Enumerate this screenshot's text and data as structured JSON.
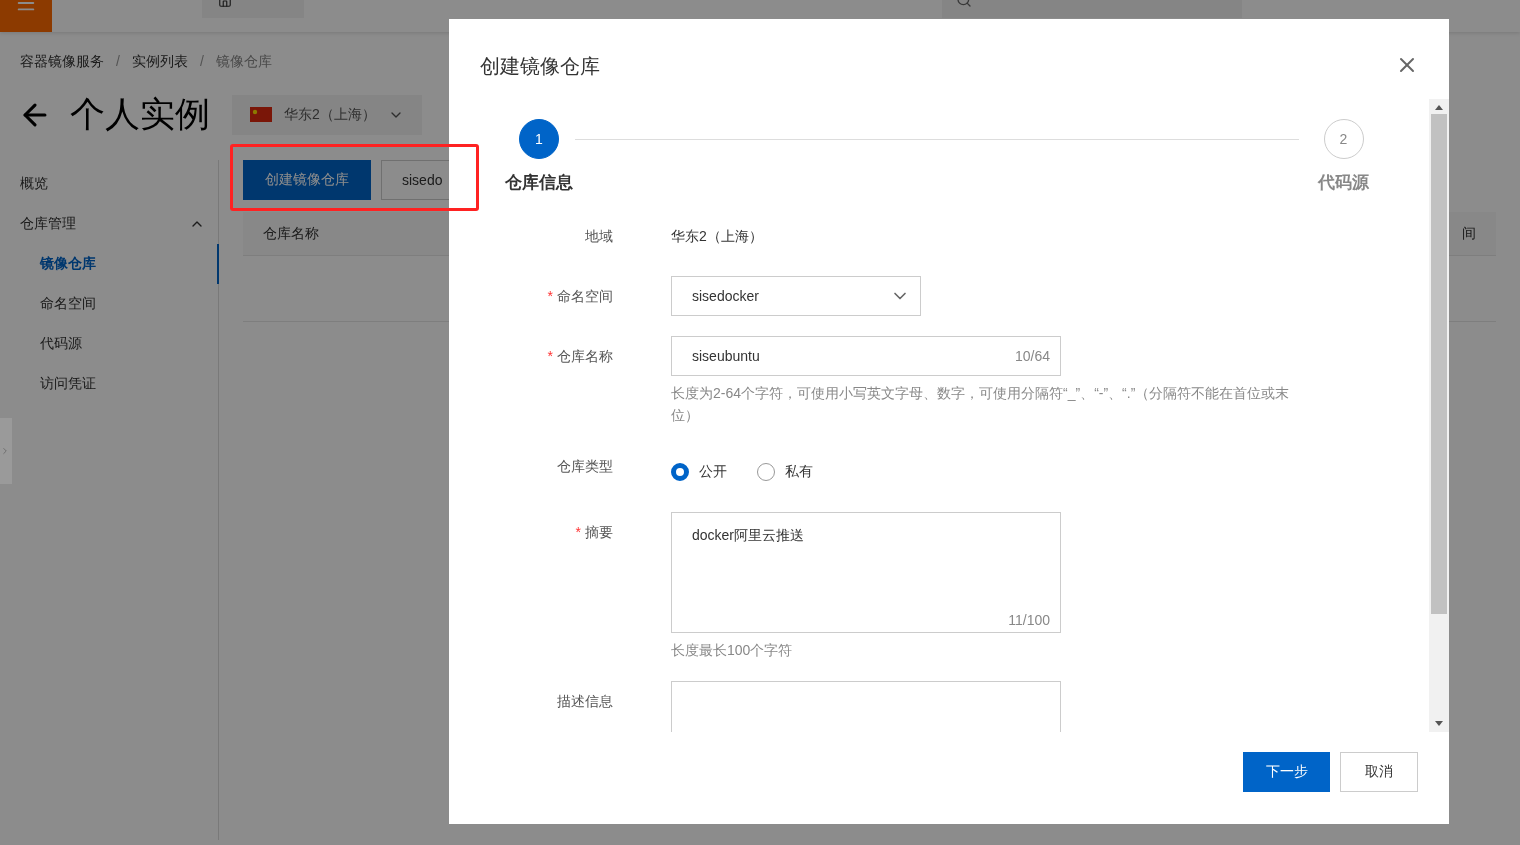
{
  "breadcrumb": {
    "items": [
      "容器镜像服务",
      "实例列表",
      "镜像仓库"
    ],
    "separator": "/"
  },
  "page_title": "个人实例",
  "region": "华东2（上海）",
  "sidebar": {
    "items": [
      {
        "label": "概览",
        "selected": false
      },
      {
        "label": "仓库管理",
        "selected": false,
        "expanded": true,
        "children": [
          {
            "label": "镜像仓库",
            "selected": true
          },
          {
            "label": "命名空间",
            "selected": false
          },
          {
            "label": "代码源",
            "selected": false
          },
          {
            "label": "访问凭证",
            "selected": false
          }
        ]
      }
    ]
  },
  "toolbar": {
    "create_button": "创建镜像仓库",
    "namespace_select": "sisedo"
  },
  "table": {
    "columns": [
      "仓库名称",
      "间"
    ]
  },
  "dialog": {
    "title": "创建镜像仓库",
    "required_mark": "*",
    "steps": [
      {
        "number": "1",
        "label": "仓库信息",
        "selected": true
      },
      {
        "number": "2",
        "label": "代码源",
        "selected": false
      }
    ],
    "fields": [
      {
        "kind": "text",
        "label": "地域",
        "required": false,
        "value": "华东2（上海）"
      },
      {
        "kind": "select",
        "label": "命名空间",
        "required": true,
        "value": "sisedocker"
      },
      {
        "kind": "input",
        "label": "仓库名称",
        "required": true,
        "value": "siseubuntu",
        "counter": "10/64",
        "hint": "长度为2-64个字符，可使用小写英文字母、数字，可使用分隔符“_”、“-”、“.”（分隔符不能在首位或末位）"
      },
      {
        "kind": "radio",
        "label": "仓库类型",
        "required": false,
        "options": [
          {
            "label": "公开",
            "selected": true
          },
          {
            "label": "私有",
            "selected": false
          }
        ]
      },
      {
        "kind": "textarea",
        "label": "摘要",
        "required": true,
        "value": "docker阿里云推送",
        "counter": "11/100",
        "hint": "长度最长100个字符"
      },
      {
        "kind": "textarea",
        "label": "描述信息",
        "required": false
      }
    ],
    "buttons": {
      "next": "下一步",
      "cancel": "取消"
    }
  }
}
